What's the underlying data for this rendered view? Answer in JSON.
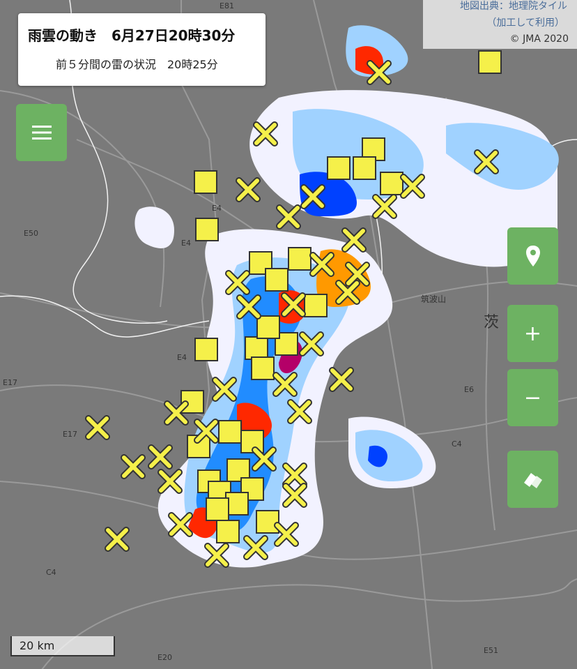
{
  "title": {
    "main": "雨雲の動き　6月27日20時30分",
    "sub": "前５分間の雷の状況　20時25分"
  },
  "attribution": {
    "line1": "地図出典：地理院タイル",
    "line2": "（加工して利用）",
    "line3": "© JMA 2020"
  },
  "scale_label": "20 km",
  "places": {
    "ibaraki": "茨",
    "tsukubasan": "筑波山"
  },
  "roads": [
    "E81",
    "E4",
    "E4",
    "E50",
    "E4",
    "E17",
    "E17",
    "E6",
    "C4",
    "C4",
    "E20",
    "E51"
  ],
  "colors": {
    "base": "#7a7a7a",
    "rain_light": "#f2f2ff",
    "rain_blue1": "#a0d2ff",
    "rain_blue2": "#218cff",
    "rain_blue3": "#0041ff",
    "rain_yellow": "#faf500",
    "rain_orange": "#ff9900",
    "rain_red": "#ff2800",
    "rain_purple": "#b40068",
    "lightning": "#f5f04a",
    "button": "#6db262"
  },
  "icons": {
    "menu": "menu-icon",
    "location": "location-pin-icon",
    "zoom_in": "plus-icon",
    "zoom_out": "minus-icon",
    "layers": "layers-icon",
    "lightning_square": "lightning-square-icon",
    "lightning_cross": "lightning-cross-icon"
  },
  "zoom_in_label": "+",
  "zoom_out_label": "−"
}
